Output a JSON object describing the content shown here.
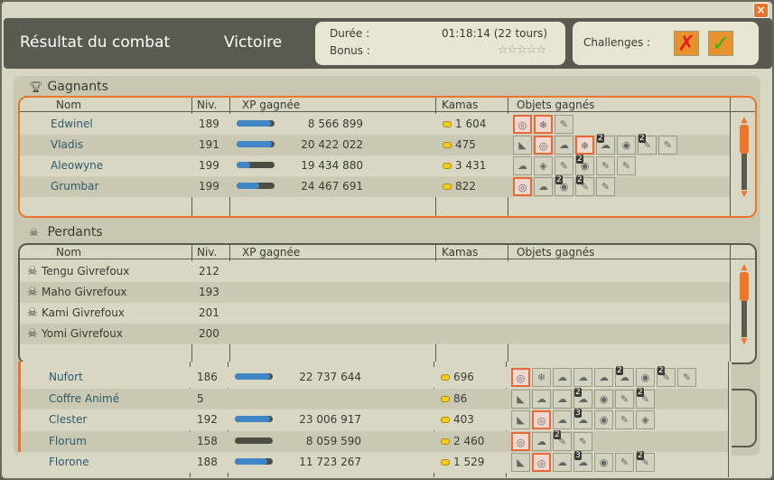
{
  "header": {
    "title": "Résultat du combat",
    "outcome": "Victoire",
    "duration_label": "Durée :",
    "duration_value": "01:18:14 (22 tours)",
    "bonus_label": "Bonus :",
    "bonus_stars": "☆☆☆☆☆",
    "challenges_label": "Challenges :",
    "close_label": "×"
  },
  "columns": {
    "name": "Nom",
    "level": "Niv.",
    "xp": "XP gagnée",
    "kamas": "Kamas",
    "items": "Objets gagnés"
  },
  "winners": {
    "title": "Gagnants",
    "rows": [
      {
        "name": "Edwinel",
        "level": "189",
        "xp": "8 566 899",
        "xp_fill": 0.9,
        "kamas": "1 604",
        "items": [
          {
            "icon": "◎",
            "hl": true
          },
          {
            "icon": "❄",
            "hl": true
          },
          {
            "icon": "✎"
          }
        ]
      },
      {
        "name": "Vladis",
        "level": "191",
        "xp": "20 422 022",
        "xp_fill": 0.92,
        "kamas": "475",
        "items": [
          {
            "icon": "◣"
          },
          {
            "icon": "◎",
            "hl": true
          },
          {
            "icon": "☁"
          },
          {
            "icon": "❄",
            "hl": true
          },
          {
            "icon": "☁",
            "q": "2"
          },
          {
            "icon": "◉"
          },
          {
            "icon": "✎",
            "q": "2"
          },
          {
            "icon": "✎"
          }
        ]
      },
      {
        "name": "Aleowyne",
        "level": "199",
        "xp": "19 434 880",
        "xp_fill": 0.35,
        "kamas": "3 431",
        "items": [
          {
            "icon": "☁"
          },
          {
            "icon": "◈"
          },
          {
            "icon": "✎"
          },
          {
            "icon": "◉",
            "q": "2"
          },
          {
            "icon": "✎"
          },
          {
            "icon": "✎"
          }
        ]
      },
      {
        "name": "Grumbar",
        "level": "199",
        "xp": "24 467 691",
        "xp_fill": 0.6,
        "kamas": "822",
        "items": [
          {
            "icon": "◎",
            "hl": true
          },
          {
            "icon": "☁"
          },
          {
            "icon": "◉",
            "q": "2"
          },
          {
            "icon": "✎",
            "q": "2"
          },
          {
            "icon": "✎"
          }
        ]
      }
    ]
  },
  "losers": {
    "title": "Perdants",
    "rows": [
      {
        "name": "Tengu Givrefoux",
        "level": "212"
      },
      {
        "name": "Maho Givrefoux",
        "level": "193"
      },
      {
        "name": "Kami Givrefoux",
        "level": "201"
      },
      {
        "name": "Yomi Givrefoux",
        "level": "200"
      }
    ]
  },
  "extra": {
    "rows": [
      {
        "name": "Nufort",
        "level": "186",
        "xp": "22 737 644",
        "xp_fill": 0.92,
        "kamas": "696",
        "items": [
          {
            "icon": "◎",
            "hl": true
          },
          {
            "icon": "❄"
          },
          {
            "icon": "☁"
          },
          {
            "icon": "☁"
          },
          {
            "icon": "☁"
          },
          {
            "icon": "☁",
            "q": "2"
          },
          {
            "icon": "◉"
          },
          {
            "icon": "✎",
            "q": "2"
          },
          {
            "icon": "✎"
          }
        ]
      },
      {
        "name": "Coffre Animé",
        "level": "5",
        "kamas": "86",
        "items": [
          {
            "icon": "◣"
          },
          {
            "icon": "☁"
          },
          {
            "icon": "☁"
          },
          {
            "icon": "☁",
            "q": "2"
          },
          {
            "icon": "◉"
          },
          {
            "icon": "✎"
          },
          {
            "icon": "✎",
            "q": "2"
          }
        ]
      },
      {
        "name": "Clester",
        "level": "192",
        "xp": "23 006 917",
        "xp_fill": 0.92,
        "kamas": "403",
        "items": [
          {
            "icon": "◣"
          },
          {
            "icon": "◎",
            "hl": true
          },
          {
            "icon": "☁"
          },
          {
            "icon": "☁",
            "q": "3"
          },
          {
            "icon": "◉"
          },
          {
            "icon": "✎"
          },
          {
            "icon": "◈"
          }
        ]
      },
      {
        "name": "Florum",
        "level": "158",
        "xp": "8 059 590",
        "xp_fill": 0.0,
        "kamas": "2 460",
        "items": [
          {
            "icon": "◎",
            "hl": true
          },
          {
            "icon": "☁"
          },
          {
            "icon": "✎",
            "q": "2"
          },
          {
            "icon": "✎"
          }
        ]
      },
      {
        "name": "Florone",
        "level": "188",
        "xp": "11 723 267",
        "xp_fill": 0.85,
        "kamas": "1 529",
        "items": [
          {
            "icon": "◣"
          },
          {
            "icon": "◎",
            "hl": true
          },
          {
            "icon": "☁"
          },
          {
            "icon": "☁",
            "q": "3"
          },
          {
            "icon": "◉"
          },
          {
            "icon": "✎"
          },
          {
            "icon": "✎",
            "q": "2"
          }
        ]
      }
    ]
  },
  "colors": {
    "accent": "#e9772b",
    "xp": "#3f86c7",
    "header": "#5a5b50",
    "panel": "#d8d7c4"
  },
  "icons": {
    "trophy": "trophy-icon",
    "skull": "skull-icon",
    "coin": "kamas-coin-icon",
    "challenge_fail": "challenge-failed-icon",
    "challenge_ok": "challenge-success-icon"
  }
}
